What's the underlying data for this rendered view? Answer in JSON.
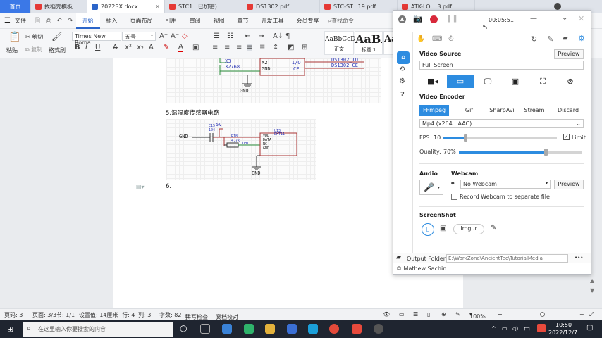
{
  "tabs": [
    {
      "label": "首页",
      "color": "#3b78e7"
    },
    {
      "label": "找稻壳模板",
      "color": "#e53935"
    },
    {
      "label": "2022SX.docx",
      "color": "#2b65c9"
    },
    {
      "label": "STC1...已加密)",
      "color": "#e53935"
    },
    {
      "label": "DS1302.pdf",
      "color": "#e53935"
    },
    {
      "label": "STC-ST...19.pdf",
      "color": "#e53935"
    },
    {
      "label": "ATK-LO....3.pdf",
      "color": "#e53935"
    }
  ],
  "menu": {
    "file": "文件",
    "items": [
      "开始",
      "插入",
      "页面布局",
      "引用",
      "审阅",
      "视图",
      "章节",
      "开发工具",
      "会员专享"
    ],
    "search": "查找命令"
  },
  "ribbon": {
    "cut": "剪切",
    "copy": "复制",
    "paste": "粘贴",
    "format_painter": "格式刷",
    "font_name": "Times New Roma",
    "font_size": "五号",
    "style_normal": "正文",
    "style_h1": "标题 1",
    "style_sample1": "AaBbCcDd",
    "style_sample2": "AaBl",
    "style_sample3": "Aa"
  },
  "document": {
    "heading": "5.温湿度传感器电路",
    "item6": "6.",
    "schem1": {
      "x3": "X3",
      "val": "32768",
      "x2": "X2",
      "gnd_pin": "GND",
      "io": "I/O",
      "ce": "CE",
      "net_io": "DS1302_IO",
      "net_ce": "DS1302_CE",
      "gnd": "GND"
    },
    "schem2": {
      "vcc": "5V",
      "c15": "C15",
      "c15v": "104",
      "gnd_left": "GND",
      "r18": "R18",
      "r18v": "4.7k",
      "net": "DHT11",
      "u13": "U13",
      "u13v": "DHT11",
      "pins": [
        "VDD",
        "DATA",
        "NC",
        "GND"
      ],
      "gnd": "GND"
    }
  },
  "status": {
    "page": "页码: 3",
    "pages": "页面: 3/3",
    "section": "节: 1/1",
    "setting": "设置值: 14厘米",
    "row": "行: 4",
    "col": "列: 3",
    "words": "字数: 82",
    "spell": "拼写检查",
    "proof": "文档校对",
    "zoom": "100%"
  },
  "taskbar": {
    "search_placeholder": "在这里输入你要搜索的内容",
    "time": "10:50",
    "date": "2022/12/7",
    "ime": "中"
  },
  "recorder": {
    "timer": "00:05:51",
    "video_source_label": "Video Source",
    "preview": "Preview",
    "source_value": "Full Screen",
    "video_encoder_label": "Video Encoder",
    "encoder_tabs": [
      "FFmpeg",
      "Gif",
      "SharpAvi",
      "Stream",
      "Discard"
    ],
    "codec": "Mp4 (x264 | AAC)",
    "fps_label": "FPS:",
    "fps_value": "10",
    "limit": "Limit",
    "quality_label": "Quality:",
    "quality_value": "70%",
    "fps_level": 0.2,
    "quality_level": 0.7,
    "audio_label": "Audio",
    "webcam_label": "Webcam",
    "webcam_value": "No Webcam",
    "webcam_preview": "Preview",
    "webcam_separate": "Record Webcam to separate file",
    "screenshot_label": "ScreenShot",
    "imgur": "Imgur",
    "output_folder_label": "Output Folder",
    "output_path": "E:\\WorkZone\\AncientTec\\TutorialMedia",
    "more": "•••",
    "credit": "© Mathew Sachin",
    "accent": "#2d8ce0"
  }
}
